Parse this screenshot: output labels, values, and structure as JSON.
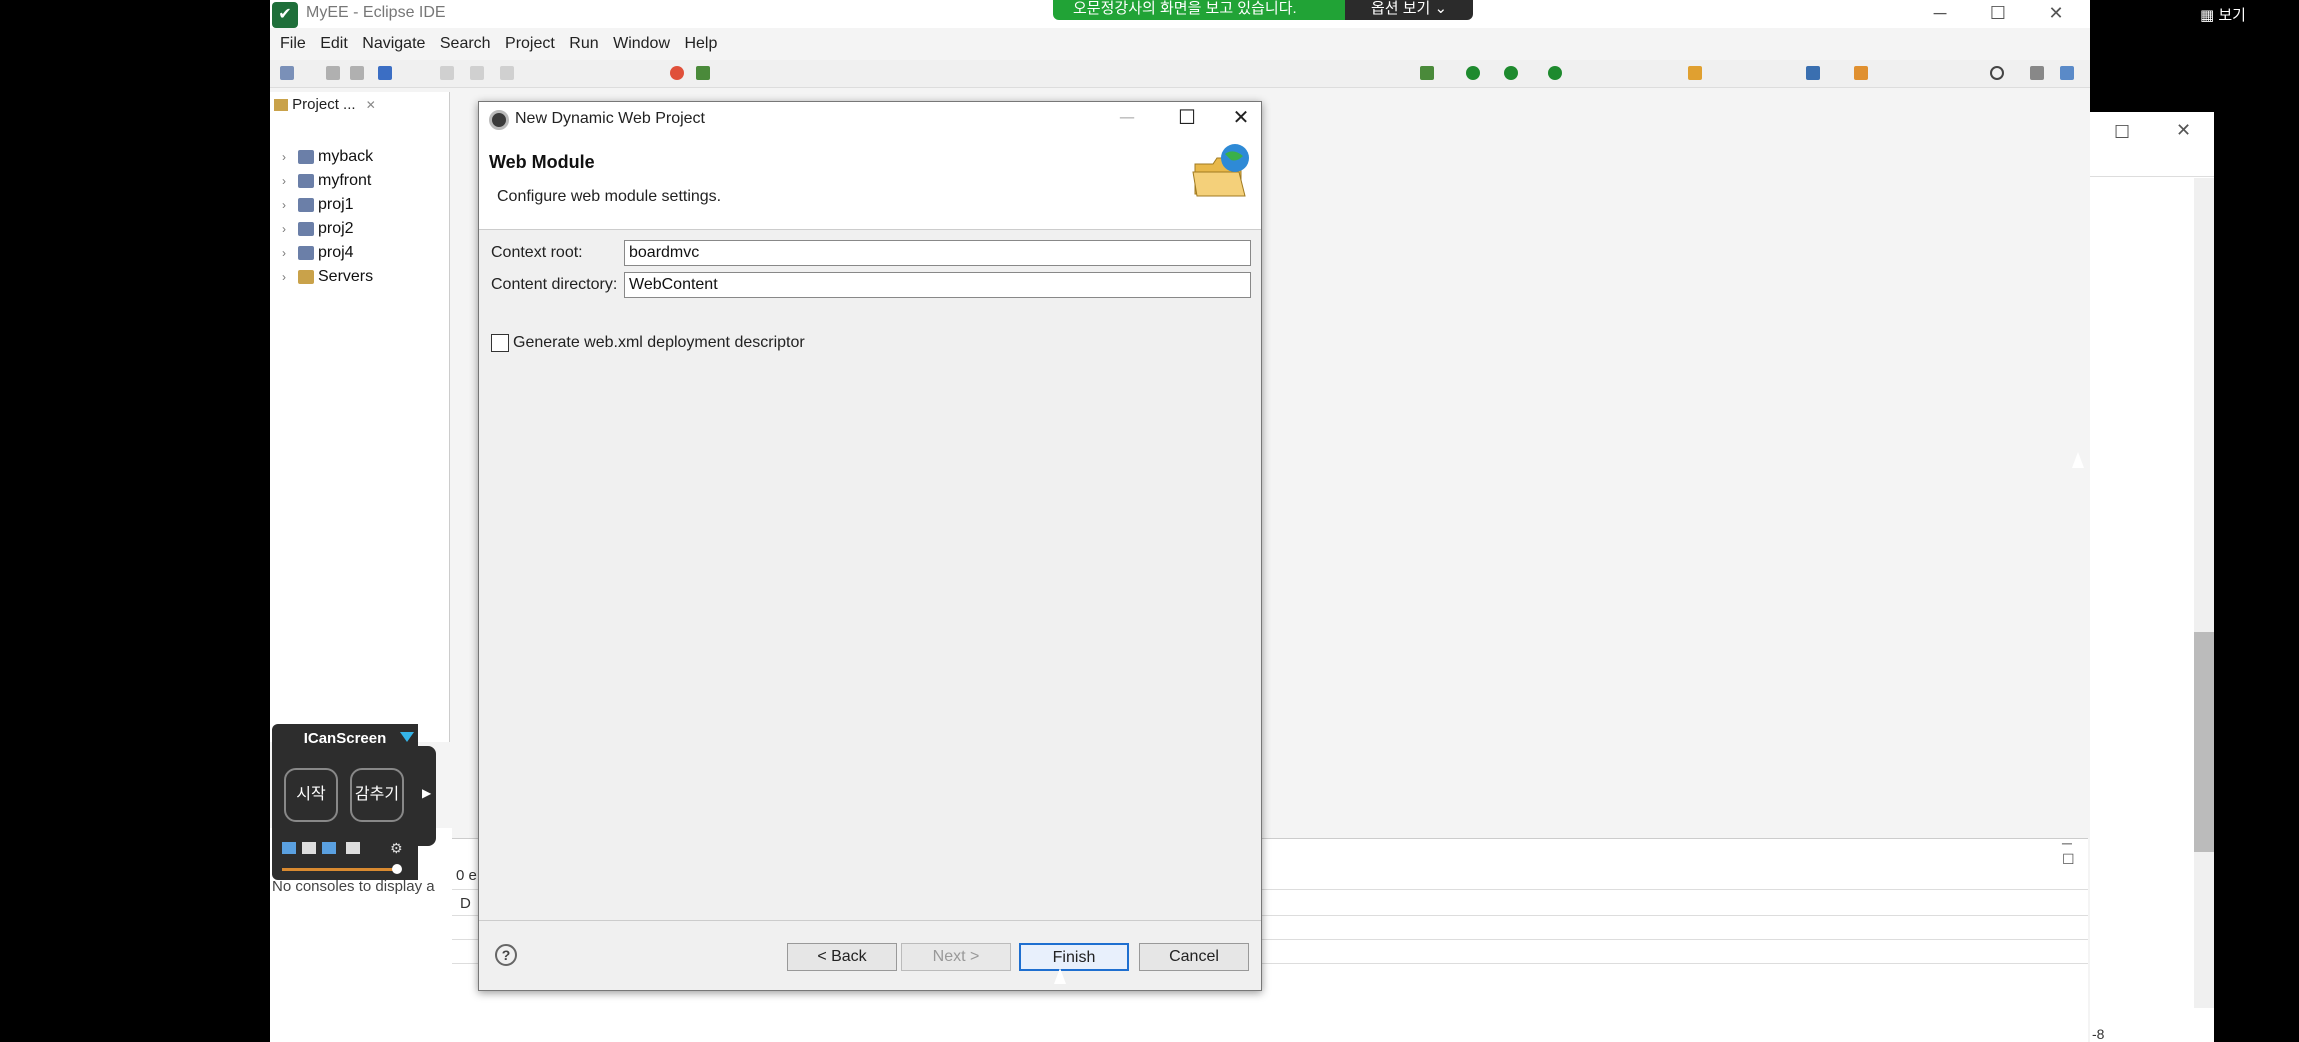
{
  "app": {
    "title": "MyEE - Eclipse IDE",
    "share_banner": "오문정강사의 화면을 보고 있습니다.",
    "share_options": "옵션 보기 ⌄",
    "watch_label": "보기"
  },
  "menubar": {
    "items": [
      "File",
      "Edit",
      "Navigate",
      "Search",
      "Project",
      "Run",
      "Window",
      "Help"
    ]
  },
  "explorer": {
    "tab_label": "Project ...",
    "items": [
      {
        "label": "myback"
      },
      {
        "label": "myfront"
      },
      {
        "label": "proj1"
      },
      {
        "label": "proj2"
      },
      {
        "label": "proj4"
      },
      {
        "label": "Servers"
      }
    ]
  },
  "console": {
    "message": "No consoles to display a",
    "count_text": "0 e",
    "col_prefix": "D"
  },
  "dialog": {
    "title": "New Dynamic Web Project",
    "heading": "Web Module",
    "description": "Configure web module settings.",
    "context_root_label": "Context root:",
    "context_root_value": "boardmvc",
    "content_dir_label": "Content directory:",
    "content_dir_value": "WebContent",
    "generate_label": "Generate web.xml deployment descriptor",
    "generate_checked": false,
    "help": "?",
    "back": "< Back",
    "next": "Next >",
    "finish": "Finish",
    "cancel": "Cancel"
  },
  "icanscreen": {
    "title": "ICanScreen",
    "start": "시작",
    "hide": "감추기"
  },
  "right_win": {
    "footer": "-8"
  },
  "colors": {
    "share_green": "#21a336",
    "default_button_border": "#1e6fd0"
  }
}
